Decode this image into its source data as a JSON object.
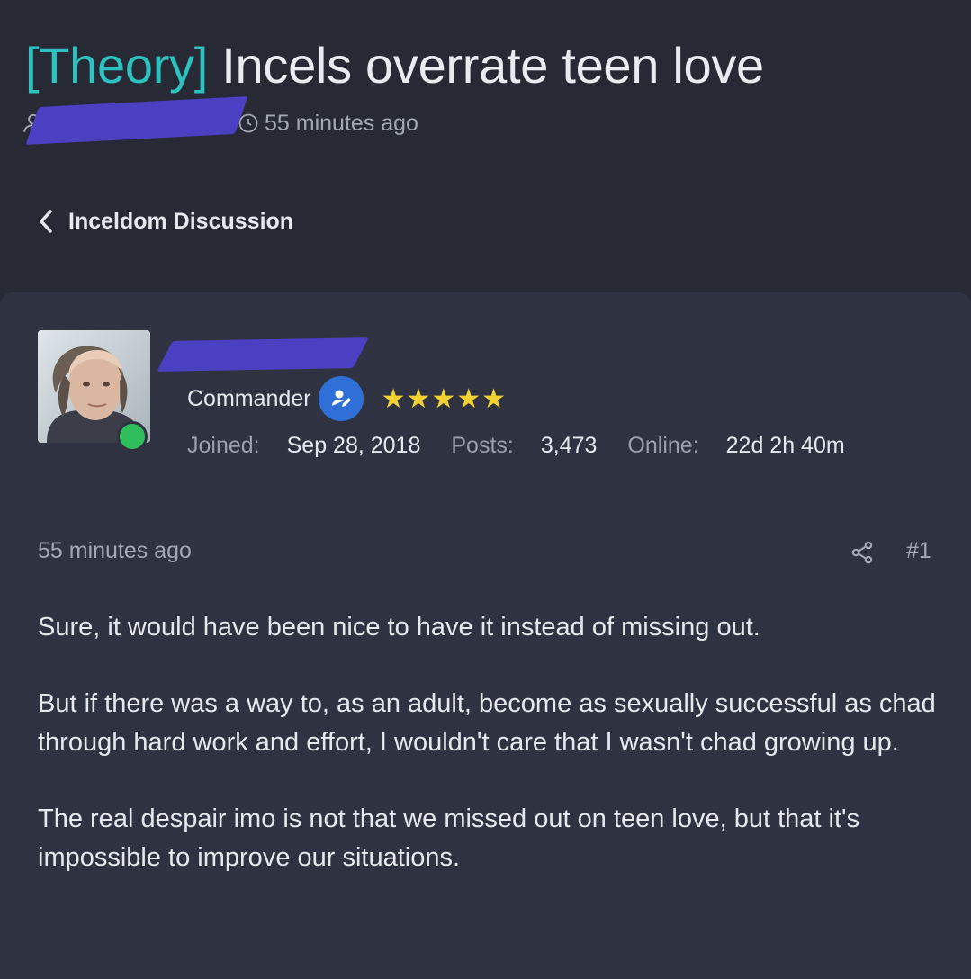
{
  "thread": {
    "prefix": "[Theory]",
    "title": "Incels overrate teen love",
    "time_ago": "55 minutes ago",
    "back_label": "Inceldom Discussion"
  },
  "user": {
    "rank": "Commander",
    "stars": "★★★★★",
    "stars_count": 5,
    "status_color": "#2fbe5b",
    "stats": {
      "joined_label": "Joined:",
      "joined_value": "Sep 28, 2018",
      "posts_label": "Posts:",
      "posts_value": "3,473",
      "online_label": "Online:",
      "online_value": "22d 2h 40m"
    }
  },
  "post": {
    "time_ago": "55 minutes ago",
    "number": "#1",
    "paragraphs": [
      "Sure, it would have been nice to have it instead of missing out.",
      "But if there was a way to, as an adult, become as sexually successful as chad through hard work and effort, I wouldn't care that I wasn't chad growing up.",
      "The real despair imo is not that we missed out on teen love, but that it's impossible to improve our situations."
    ]
  },
  "colors": {
    "background": "#272a35",
    "card": "#2f3341",
    "prefix_accent": "#2cc2c0",
    "redaction": "#4b3fc2",
    "badge": "#2e6fd8",
    "stars": "#f2d233"
  }
}
